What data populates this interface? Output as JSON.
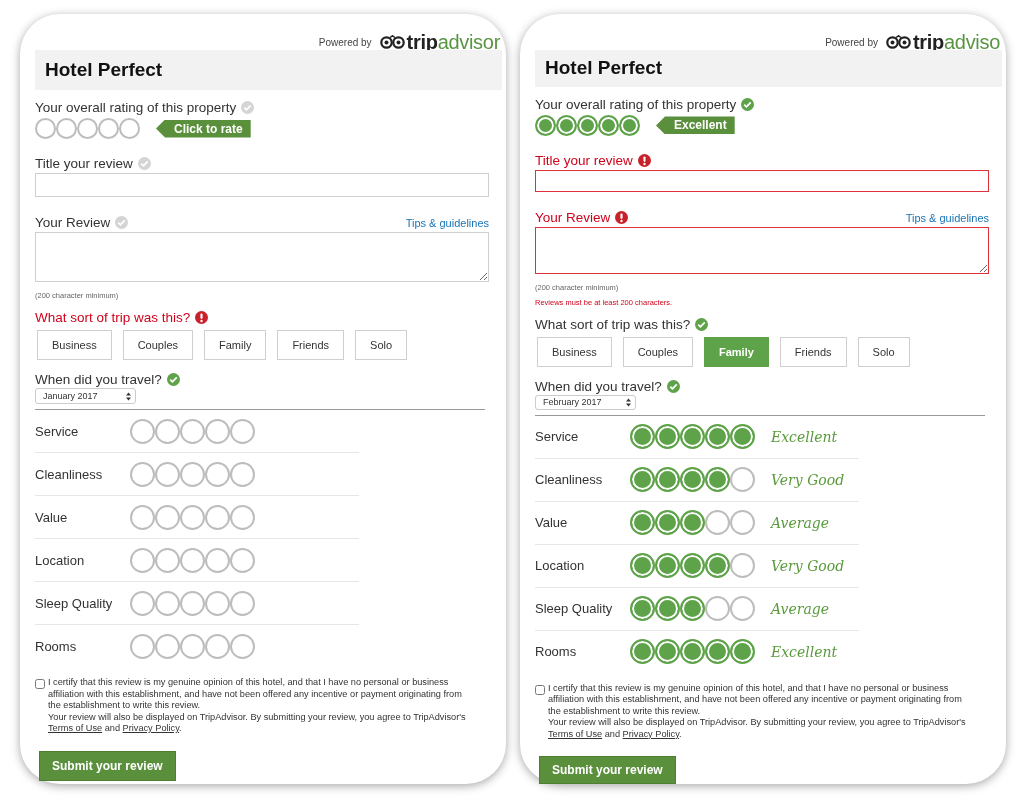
{
  "panels": [
    {
      "powered_by": "Powered by",
      "logo": {
        "dark": "trip",
        "green": "advisor"
      },
      "title": "Hotel Perfect",
      "overall": {
        "label": "Your overall rating of this property",
        "complete": false,
        "error": false,
        "stars": 0,
        "tag": "Click to rate"
      },
      "review_title": {
        "label": "Title your review",
        "complete": false,
        "error": false
      },
      "review": {
        "label": "Your Review",
        "complete": false,
        "error": false,
        "link": "Tips & guidelines",
        "hint": "(200 character minimum)"
      },
      "trip": {
        "label": "What sort of trip was this?",
        "error": true,
        "options": [
          {
            "label": "Business",
            "selected": false
          },
          {
            "label": "Couples",
            "selected": false
          },
          {
            "label": "Family",
            "selected": false
          },
          {
            "label": "Friends",
            "selected": false
          },
          {
            "label": "Solo",
            "selected": false
          }
        ]
      },
      "travel": {
        "label": "When did you travel?",
        "complete": true,
        "error": false,
        "value": "January 2017"
      },
      "categories": [
        {
          "name": "Service",
          "stars": 0
        },
        {
          "name": "Cleanliness",
          "stars": 0
        },
        {
          "name": "Value",
          "stars": 0
        },
        {
          "name": "Location",
          "stars": 0
        },
        {
          "name": "Sleep Quality",
          "stars": 0
        },
        {
          "name": "Rooms",
          "stars": 0
        }
      ],
      "certify": {
        "checked": false,
        "text": "I certify that this review is my genuine opinion of this hotel, and that I have no personal or business affiliation with this establishment, and have not been offered any incentive or payment originating from the establishment to write this review.",
        "notice": "Your review will also be displayed on TripAdvisor. By submitting your review, you agree to TripAdvisor's",
        "terms": "Terms of Use",
        "and": "and",
        "privacy": "Privacy Policy",
        "end": "."
      },
      "submit": "Submit your review"
    },
    {
      "powered_by": "Powered by",
      "logo": {
        "dark": "trip",
        "green": "adviso"
      },
      "title": "Hotel Perfect",
      "overall": {
        "label": "Your overall rating of this property",
        "complete": true,
        "error": false,
        "stars": 5,
        "tag": "Excellent"
      },
      "review_title": {
        "label": "Title your review",
        "error": true
      },
      "review": {
        "label": "Your Review",
        "error": true,
        "link": "Tips & guidelines",
        "hint": "(200 character minimum)",
        "error_message": "Reviews must be at least 200 characters."
      },
      "trip": {
        "label": "What sort of trip was this?",
        "complete": true,
        "error": false,
        "options": [
          {
            "label": "Business",
            "selected": false
          },
          {
            "label": "Couples",
            "selected": false
          },
          {
            "label": "Family",
            "selected": true
          },
          {
            "label": "Friends",
            "selected": false
          },
          {
            "label": "Solo",
            "selected": false
          }
        ]
      },
      "travel": {
        "label": "When did you travel?",
        "complete": true,
        "error": false,
        "value": "February 2017"
      },
      "categories": [
        {
          "name": "Service",
          "stars": 5,
          "rating": "Excellent"
        },
        {
          "name": "Cleanliness",
          "stars": 4,
          "rating": "Very Good"
        },
        {
          "name": "Value",
          "stars": 3,
          "rating": "Average"
        },
        {
          "name": "Location",
          "stars": 4,
          "rating": "Very Good"
        },
        {
          "name": "Sleep Quality",
          "stars": 3,
          "rating": "Average"
        },
        {
          "name": "Rooms",
          "stars": 5,
          "rating": "Excellent"
        }
      ],
      "certify": {
        "checked": false,
        "text": "I certify that this review is my genuine opinion of this hotel, and that I have no personal or business affiliation with this establishment, and have not been offered any incentive or payment originating from the establishment to write this review.",
        "notice": "Your review will also be displayed on TripAdvisor. By submitting your review, you agree to TripAdvisor's",
        "terms": "Terms of Use",
        "and": "and",
        "privacy": "Privacy Policy",
        "end": "."
      },
      "submit": "Submit your review"
    }
  ]
}
